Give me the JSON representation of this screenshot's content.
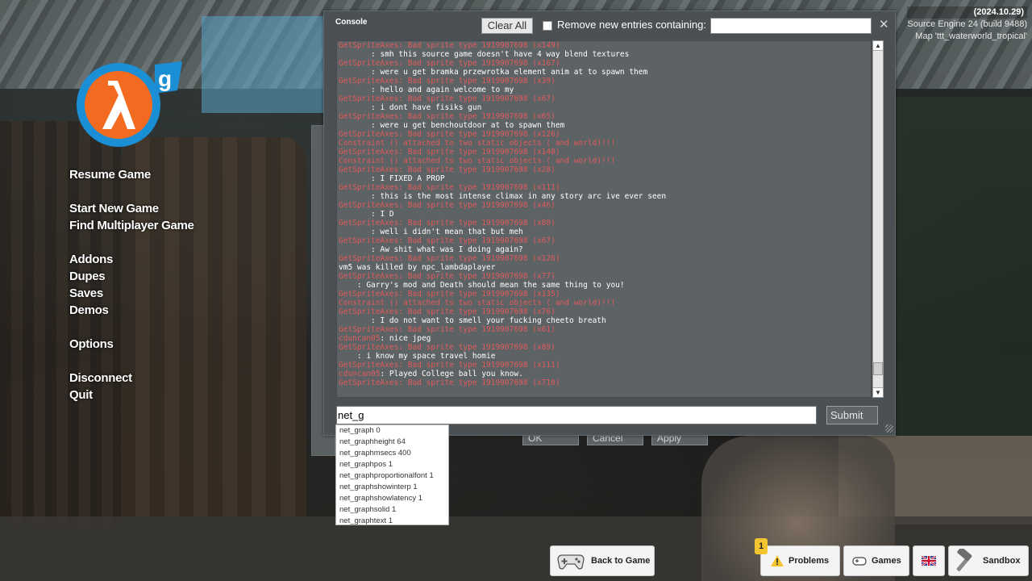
{
  "version": {
    "notice": "(2024.10.29)",
    "engine": "Source Engine 24 (build 9488)",
    "map": "Map 'ttt_waterworld_tropical'"
  },
  "menu": {
    "resume": "Resume Game",
    "start_new": "Start New Game",
    "find_multiplayer": "Find Multiplayer Game",
    "addons": "Addons",
    "dupes": "Dupes",
    "saves": "Saves",
    "demos": "Demos",
    "options": "Options",
    "disconnect": "Disconnect",
    "quit": "Quit"
  },
  "background_dialog": {
    "ok": "OK",
    "cancel": "Cancel",
    "apply": "Apply"
  },
  "console": {
    "title": "Console",
    "clear_all": "Clear All",
    "remove_label": "Remove new entries containing:",
    "remove_value": "",
    "close_glyph": "✕",
    "input_value": "net_g",
    "submit": "Submit",
    "log": [
      {
        "type": "err",
        "text": "GetSpriteAxes: Bad sprite type 1919907698 (x149)"
      },
      {
        "type": "txt",
        "text": "       : smh this source game doesn't have 4 way blend textures"
      },
      {
        "type": "err",
        "text": "GetSpriteAxes: Bad sprite type 1919907698 (x167)"
      },
      {
        "type": "txt",
        "text": "       : were u get bramka przewrotka element anim at to spawn them"
      },
      {
        "type": "err",
        "text": "GetSpriteAxes: Bad sprite type 1919907698 (x39)"
      },
      {
        "type": "txt",
        "text": "       : hello and again welcome to my"
      },
      {
        "type": "err",
        "text": "GetSpriteAxes: Bad sprite type 1919907698 (x67)"
      },
      {
        "type": "txt",
        "text": "       : i dont have fisiks gun"
      },
      {
        "type": "err",
        "text": "GetSpriteAxes: Bad sprite type 1919907698 (x65)"
      },
      {
        "type": "txt",
        "text": "       : were u get benchoutdoor at to spawn them"
      },
      {
        "type": "err",
        "text": "GetSpriteAxes: Bad sprite type 1919907698 (x126)"
      },
      {
        "type": "err",
        "text": "Constraint () attached to two static objects ( and world)!!!"
      },
      {
        "type": "err",
        "text": "GetSpriteAxes: Bad sprite type 1919907698 (x140)"
      },
      {
        "type": "err",
        "text": "Constraint () attached to two static objects ( and world)!!!"
      },
      {
        "type": "err",
        "text": "GetSpriteAxes: Bad sprite type 1919907698 (x28)"
      },
      {
        "type": "txt",
        "text": "       : I FIXED A PROP"
      },
      {
        "type": "err",
        "text": "GetSpriteAxes: Bad sprite type 1919907698 (x111)"
      },
      {
        "type": "txt",
        "text": "       : this is the most intense climax in any story arc ive ever seen"
      },
      {
        "type": "err",
        "text": "GetSpriteAxes: Bad sprite type 1919907698 (x46)"
      },
      {
        "type": "txt",
        "text": "       : I D"
      },
      {
        "type": "err",
        "text": "GetSpriteAxes: Bad sprite type 1919907698 (x80)"
      },
      {
        "type": "txt",
        "text": "       : well i didn't mean that but meh"
      },
      {
        "type": "err",
        "text": "GetSpriteAxes: Bad sprite type 1919907698 (x67)"
      },
      {
        "type": "txt",
        "text": "       : Aw shit what was I doing again?"
      },
      {
        "type": "err",
        "text": "GetSpriteAxes: Bad sprite type 1919907698 (x126)"
      },
      {
        "type": "txt",
        "text": "vm5 was killed by npc_lambdaplayer"
      },
      {
        "type": "err",
        "text": "GetSpriteAxes: Bad sprite type 1919907698 (x77)"
      },
      {
        "type": "txt",
        "text": "    : Garry's mod and Death should mean the same thing to you!"
      },
      {
        "type": "err",
        "text": "GetSpriteAxes: Bad sprite type 1919907698 (x135)"
      },
      {
        "type": "err",
        "text": "Constraint () attached to two static objects ( and world)!!!"
      },
      {
        "type": "err",
        "text": "GetSpriteAxes: Bad sprite type 1919907698 (x76)"
      },
      {
        "type": "txt",
        "text": "       : I do not want to smell your fucking cheeto breath"
      },
      {
        "type": "err",
        "text": "GetSpriteAxes: Bad sprite type 1919907698 (x61)"
      },
      {
        "type": "mix",
        "name": "cduncan05",
        "text": ": nice jpeg"
      },
      {
        "type": "err",
        "text": "GetSpriteAxes: Bad sprite type 1919907698 (x89)"
      },
      {
        "type": "txt",
        "text": "    : i know my space travel homie"
      },
      {
        "type": "err",
        "text": "GetSpriteAxes: Bad sprite type 1919907698 (x111)"
      },
      {
        "type": "mix",
        "name": "cduncan05",
        "text": ": Played College ball you know."
      },
      {
        "type": "err",
        "text": "GetSpriteAxes: Bad sprite type 1919907698 (x710)"
      }
    ]
  },
  "autocomplete": [
    "net_graph 0",
    "net_graphheight 64",
    "net_graphmsecs 400",
    "net_graphpos 1",
    "net_graphproportionalfont 1",
    "net_graphshowinterp 1",
    "net_graphshowlatency 1",
    "net_graphsolid 1",
    "net_graphtext 1"
  ],
  "bottom_bar": {
    "back_to_game": "Back to Game",
    "problems": "Problems",
    "problems_count": "1",
    "games": "Games",
    "sandbox": "Sandbox"
  },
  "colors": {
    "error_text": "#e05b5b",
    "console_bg": "#4b5054",
    "logo_orange": "#f26b21",
    "logo_blue": "#1a8fd6"
  }
}
